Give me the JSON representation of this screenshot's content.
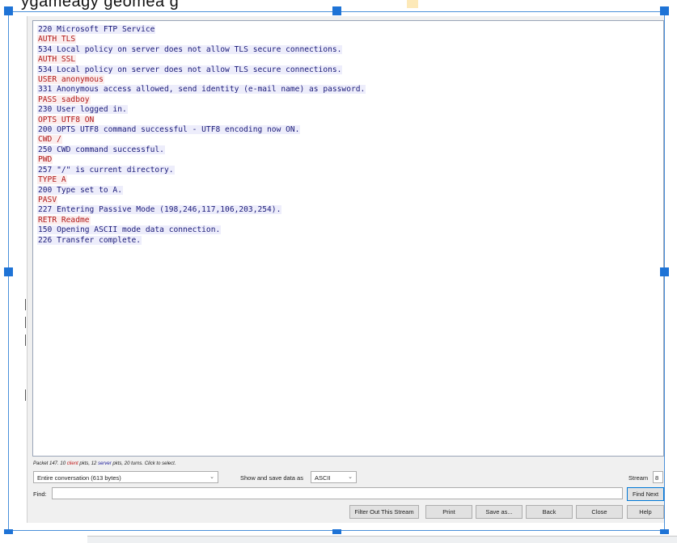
{
  "top_snippet": "ygameagy geomea g",
  "stream_lines": [
    {
      "dir": "server",
      "text": "220 Microsoft FTP Service"
    },
    {
      "dir": "client",
      "text": "AUTH TLS"
    },
    {
      "dir": "server",
      "text": "534 Local policy on server does not allow TLS secure connections."
    },
    {
      "dir": "client",
      "text": "AUTH SSL"
    },
    {
      "dir": "server",
      "text": "534 Local policy on server does not allow TLS secure connections."
    },
    {
      "dir": "client",
      "text": "USER anonymous"
    },
    {
      "dir": "server",
      "text": "331 Anonymous access allowed, send identity (e-mail name) as password."
    },
    {
      "dir": "client",
      "text": "PASS sadboy"
    },
    {
      "dir": "server",
      "text": "230 User logged in."
    },
    {
      "dir": "client",
      "text": "OPTS UTF8 ON"
    },
    {
      "dir": "server",
      "text": "200 OPTS UTF8 command successful - UTF8 encoding now ON."
    },
    {
      "dir": "client",
      "text": "CWD /"
    },
    {
      "dir": "server",
      "text": "250 CWD command successful."
    },
    {
      "dir": "client",
      "text": "PWD"
    },
    {
      "dir": "server",
      "text": "257 \"/\" is current directory."
    },
    {
      "dir": "client",
      "text": "TYPE A"
    },
    {
      "dir": "server",
      "text": "200 Type set to A."
    },
    {
      "dir": "client",
      "text": "PASV"
    },
    {
      "dir": "server",
      "text": "227 Entering Passive Mode (198,246,117,106,203,254)."
    },
    {
      "dir": "client",
      "text": "RETR Readme"
    },
    {
      "dir": "server",
      "text": "150 Opening ASCII mode data connection."
    },
    {
      "dir": "server",
      "text": "226 Transfer complete."
    }
  ],
  "status": {
    "prefix": "Packet 147. 10 ",
    "client_label": "client",
    "middle": " pkts, 12 ",
    "server_label": "server",
    "suffix": " pkts, 20 turns. Click to select."
  },
  "conversation_select": {
    "value": "Entire conversation (613 bytes)"
  },
  "show_save": {
    "label": "Show and save data as",
    "value": "ASCII"
  },
  "stream": {
    "label": "Stream",
    "value": "8"
  },
  "find": {
    "label": "Find:",
    "value": "",
    "button": "Find Next"
  },
  "buttons": {
    "filter": "Filter Out This Stream",
    "print": "Print",
    "save": "Save as...",
    "back": "Back",
    "close": "Close",
    "help": "Help"
  },
  "colors": {
    "client_text": "#b01818",
    "client_bg": "#fbeded",
    "server_text": "#1a1a78",
    "server_bg": "#ededfb",
    "selection_handle": "#1e73d6"
  }
}
